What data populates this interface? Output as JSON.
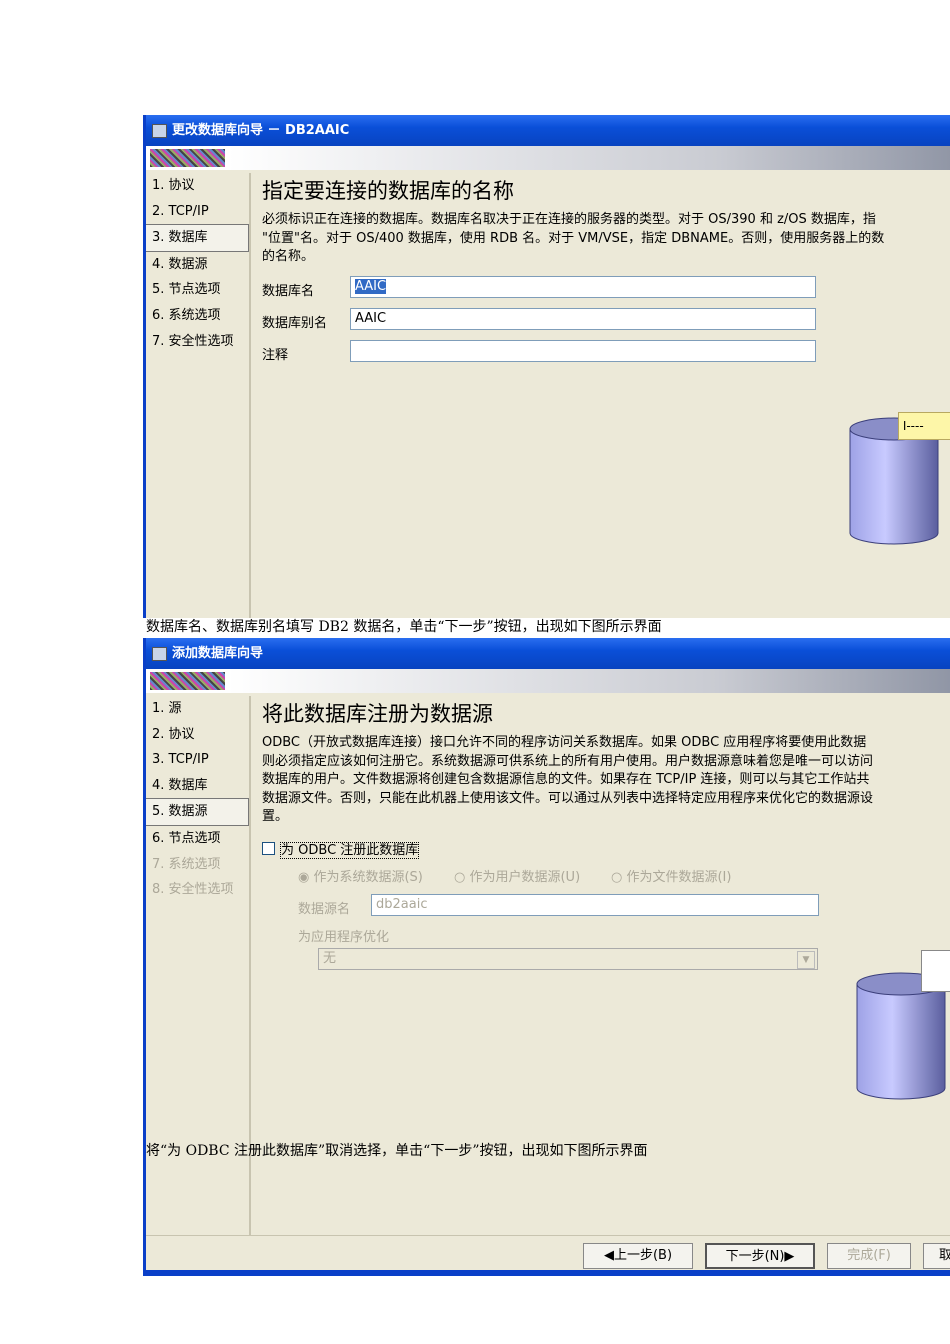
{
  "dialog1": {
    "title": "更改数据库向导 － DB2AAIC",
    "nav": [
      "1. 协议",
      "2. TCP/IP",
      "3. 数据库",
      "4. 数据源",
      "5. 节点选项",
      "6. 系统选项",
      "7. 安全性选项"
    ],
    "heading": "指定要连接的数据库的名称",
    "desc": [
      "必须标识正在连接的数据库。数据库名取决于正在连接的服务器的类型。对于 OS/390 和 z/OS 数据库，指",
      "\"位置\"名。对于 OS/400 数据库，使用 RDB 名。对于 VM/VSE，指定 DBNAME。否则，使用服务器上的数",
      "的名称。"
    ],
    "db_name_label": "数据库名",
    "db_name_value": "AAIC",
    "alias_label": "数据库别名",
    "alias_value": "AAIC",
    "comment_label": "注释",
    "comment_value": ""
  },
  "caption1": "数据库名、数据库别名填写 DB2 数据名，单击“下一步”按钮，出现如下图所示界面",
  "dialog2": {
    "title": "添加数据库向导",
    "nav": [
      "1. 源",
      "2. 协议",
      "3. TCP/IP",
      "4. 数据库",
      "5. 数据源",
      "6. 节点选项",
      "7. 系统选项",
      "8. 安全性选项"
    ],
    "heading": "将此数据库注册为数据源",
    "desc": [
      "ODBC（开放式数据库连接）接口允许不同的程序访问关系数据库。如果 ODBC 应用程序将要使用此数据",
      "则必须指定应该如何注册它。系统数据源可供系统上的所有用户使用。用户数据源意味着您是唯一可以访问",
      "数据库的用户。文件数据源将创建包含数据源信息的文件。如果存在 TCP/IP 连接，则可以与其它工作站共",
      "数据源文件。否则，只能在此机器上使用该文件。可以通过从列表中选择特定应用程序来优化它的数据源设",
      "置。"
    ],
    "register_checkbox": "为 ODBC 注册此数据库",
    "radios": [
      "作为系统数据源(S)",
      "作为用户数据源(U)",
      "作为文件数据源(I)"
    ],
    "dsn_label": "数据源名",
    "dsn_value": "db2aaic",
    "optimize_label": "为应用程序优化",
    "optimize_value": "无",
    "buttons": {
      "back": "◀上一步(B)",
      "next": "下一步(N)▶",
      "finish": "完成(F)",
      "cancel": "取"
    }
  },
  "caption2": "将“为 ODBC 注册此数据库”取消选择，单击“下一步”按钮，出现如下图所示界面"
}
